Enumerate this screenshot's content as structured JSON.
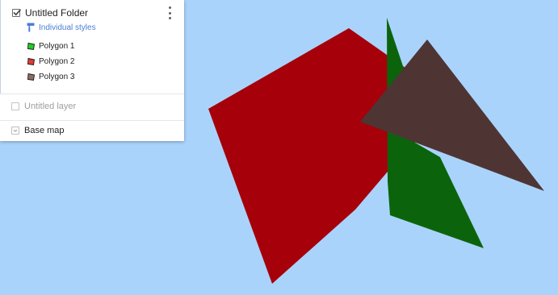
{
  "map": {
    "background_color": "#aad3fb",
    "polygons": [
      {
        "name": "Polygon 2",
        "fill": "#a6000a"
      },
      {
        "name": "Polygon 1",
        "fill": "#0b640b"
      },
      {
        "name": "Polygon 3",
        "fill": "#4e3533"
      }
    ]
  },
  "panel": {
    "folder": {
      "title": "Untitled Folder",
      "checked": true,
      "menu_icon": "more-vert-icon"
    },
    "styles_link": {
      "label": "Individual styles",
      "icon": "paint-roller-icon",
      "color": "#4a7fd4"
    },
    "features": [
      {
        "label": "Polygon 1",
        "icon": "polygon-icon",
        "color": "#1fd11f"
      },
      {
        "label": "Polygon 2",
        "icon": "polygon-icon",
        "color": "#e53935"
      },
      {
        "label": "Polygon 3",
        "icon": "polygon-icon",
        "color": "#8d6e63"
      }
    ],
    "layer": {
      "title": "Untitled layer",
      "checked": false
    },
    "basemap": {
      "label": "Base map",
      "icon": "chevron-down-icon"
    }
  }
}
